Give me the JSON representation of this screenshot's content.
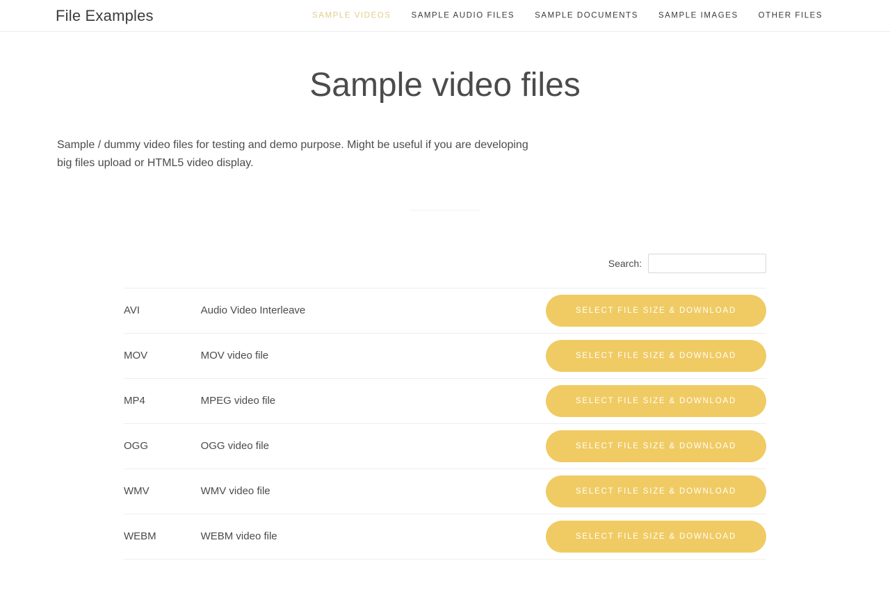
{
  "header": {
    "brand": "File Examples",
    "nav": [
      {
        "label": "SAMPLE VIDEOS",
        "active": true
      },
      {
        "label": "SAMPLE AUDIO FILES",
        "active": false
      },
      {
        "label": "SAMPLE DOCUMENTS",
        "active": false
      },
      {
        "label": "SAMPLE IMAGES",
        "active": false
      },
      {
        "label": "OTHER FILES",
        "active": false
      }
    ]
  },
  "main": {
    "title": "Sample video files",
    "intro": "Sample / dummy video files for testing and demo purpose. Might be useful if you are developing big files upload or HTML5 video display."
  },
  "search": {
    "label": "Search:",
    "value": "",
    "placeholder": ""
  },
  "table": {
    "rows": [
      {
        "extension": "AVI",
        "description": "Audio Video Interleave",
        "action": "SELECT FILE SIZE & DOWNLOAD"
      },
      {
        "extension": "MOV",
        "description": "MOV video file",
        "action": "SELECT FILE SIZE & DOWNLOAD"
      },
      {
        "extension": "MP4",
        "description": "MPEG video file",
        "action": "SELECT FILE SIZE & DOWNLOAD"
      },
      {
        "extension": "OGG",
        "description": "OGG video file",
        "action": "SELECT FILE SIZE & DOWNLOAD"
      },
      {
        "extension": "WMV",
        "description": "WMV video file",
        "action": "SELECT FILE SIZE & DOWNLOAD"
      },
      {
        "extension": "WEBM",
        "description": "WEBM video file",
        "action": "SELECT FILE SIZE & DOWNLOAD"
      }
    ]
  },
  "colors": {
    "accent": "#f0cb63",
    "active_nav": "#e2ce8e",
    "text": "#4b4b4b",
    "border": "#eeeeee"
  }
}
